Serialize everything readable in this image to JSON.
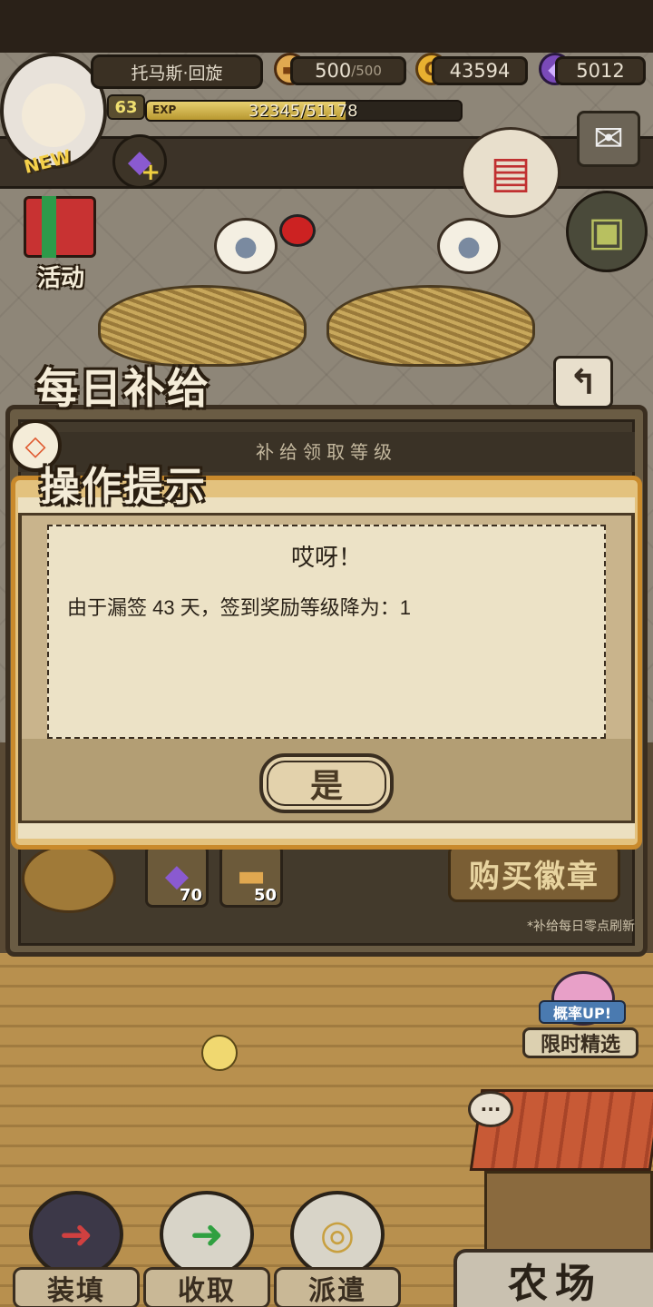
{
  "player": {
    "name": "托马斯·回旋",
    "level": "63",
    "exp_label": "EXP",
    "exp_current": 32345,
    "exp_max": 51178,
    "exp_text": "32345/51178",
    "new_tag": "NEW"
  },
  "resources": {
    "bread": {
      "value": "500",
      "max": "/500",
      "icon": "bread-icon"
    },
    "gold": {
      "value": "43594",
      "icon": "gold-coin-icon",
      "glyph": "G"
    },
    "gem": {
      "value": "5012",
      "icon": "purple-gem-icon"
    }
  },
  "side_buttons": {
    "event_label": "活动"
  },
  "daily_panel": {
    "title": "每日补给",
    "subheader": "补给领取等级",
    "rewards": [
      {
        "icon": "purple-gem-icon",
        "qty": "70"
      },
      {
        "icon": "bread-icon",
        "qty": "50"
      }
    ],
    "buy_badge_label": "购买徽章",
    "refresh_note": "*补给每日零点刷新"
  },
  "modal": {
    "title": "操作提示",
    "heading": "哎呀！",
    "message": "由于漏签 43 天，签到奖励等级降为：1",
    "confirm_label": "是"
  },
  "limited": {
    "badge": "概率UP!",
    "label": "限时精选"
  },
  "bottom_nav": {
    "load_label": "装填",
    "collect_label": "收取",
    "dispatch_label": "派遣",
    "farm_label": "农场"
  },
  "colors": {
    "modal_border": "#c98a2c",
    "paper": "#ece2c6",
    "gem": "#8a5ad0",
    "gold": "#e8b030"
  }
}
